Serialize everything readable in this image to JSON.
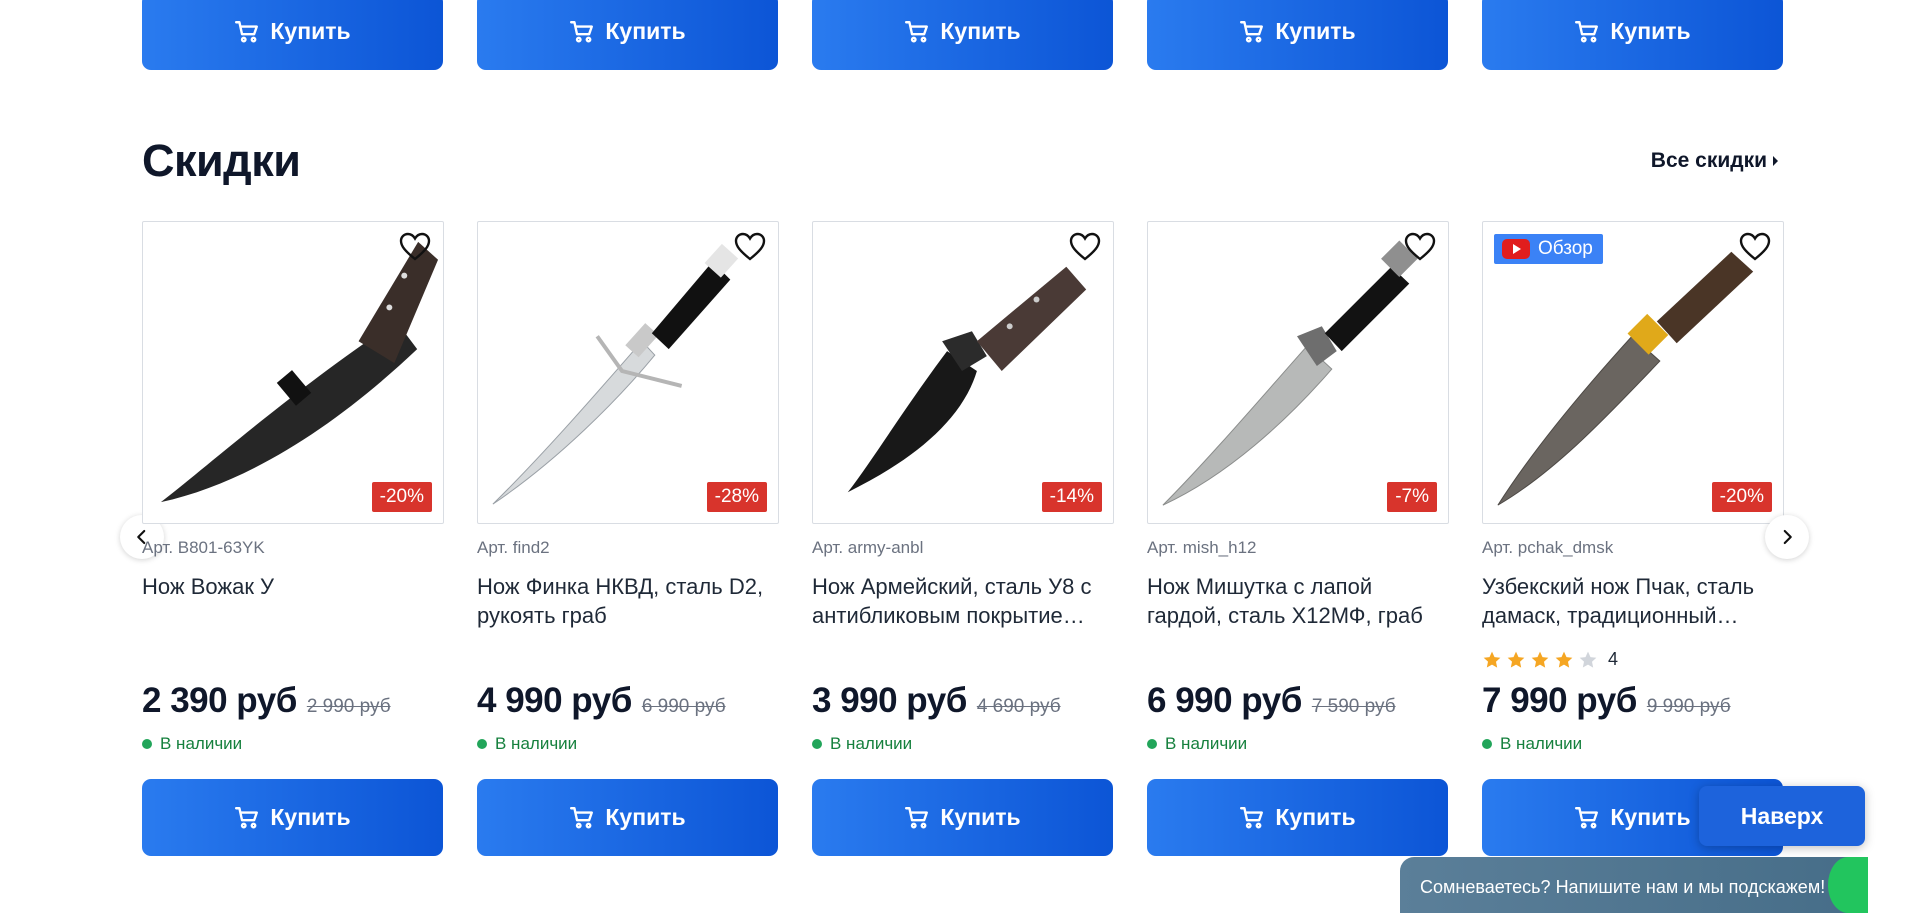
{
  "buy_label": "Купить",
  "section": {
    "title": "Скидки",
    "all_link": "Все скидки"
  },
  "products": [
    {
      "sku": "Арт. B801-63YK",
      "name": "Нож Вожак У",
      "price": "2 390 руб",
      "old_price": "2 990 руб",
      "discount": "-20%",
      "stock": "В наличии"
    },
    {
      "sku": "Арт. find2",
      "name": "Нож Финка НКВД, сталь D2, рукоять граб",
      "price": "4 990 руб",
      "old_price": "6 990 руб",
      "discount": "-28%",
      "stock": "В наличии"
    },
    {
      "sku": "Арт. army-anbl",
      "name": "Нож Армейский, сталь У8 с антибликовым покрытие…",
      "price": "3 990 руб",
      "old_price": "4 690 руб",
      "discount": "-14%",
      "stock": "В наличии"
    },
    {
      "sku": "Арт. mish_h12",
      "name": "Нож Мишутка с лапой гардой, сталь Х12МФ, граб",
      "price": "6 990 руб",
      "old_price": "7 590 руб",
      "discount": "-7%",
      "stock": "В наличии"
    },
    {
      "sku": "Арт. pchak_dmsk",
      "name": "Узбекский нож Пчак, сталь дамаск, традиционный…",
      "price": "7 990 руб",
      "old_price": "9 990 руб",
      "discount": "-20%",
      "stock": "В наличии",
      "badge": "Обзор",
      "rating_count": "4",
      "rating": 4
    }
  ],
  "up_button": "Наверх",
  "chat_text": "Сомневаетесь? Напишите нам и мы подскажем!",
  "colors": {
    "accent": "#1d63dc",
    "discount": "#d8342c",
    "in_stock": "#22a55a",
    "star": "#f5a623"
  }
}
